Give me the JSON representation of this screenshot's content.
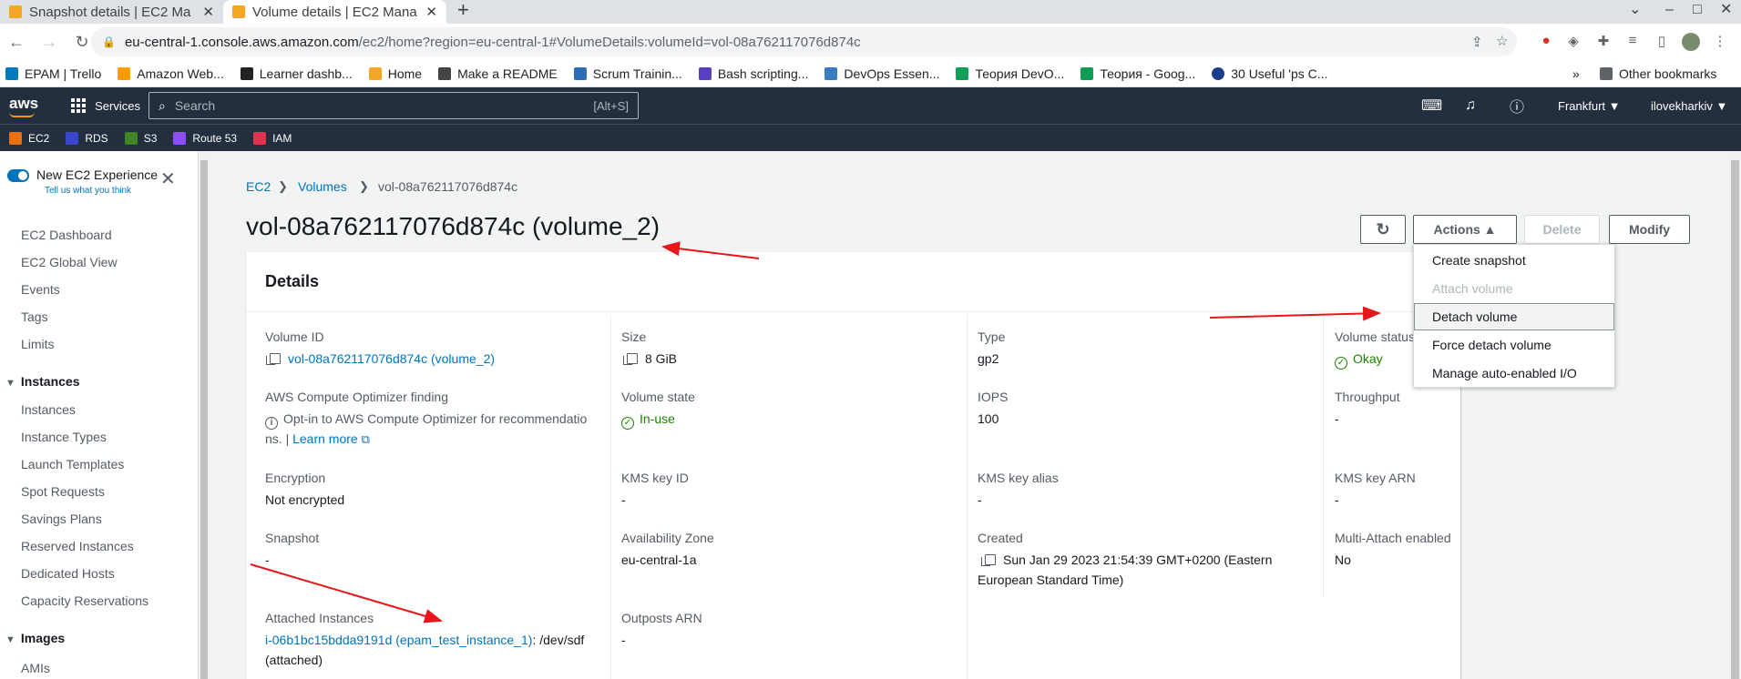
{
  "browser": {
    "tabs": [
      {
        "title": "Snapshot details | EC2 Ma"
      },
      {
        "title": "Volume details | EC2 Mana"
      }
    ],
    "url_host": "eu-central-1.console.aws.amazon.com",
    "url_rest": "/ec2/home?region=eu-central-1#VolumeDetails:volumeId=vol-08a762117076d874c",
    "bookmarks": [
      {
        "label": "EPAM | Trello",
        "color": "#0079bf"
      },
      {
        "label": "Amazon Web...",
        "color": "#ff9900"
      },
      {
        "label": "Learner dashb...",
        "color": "#222222"
      },
      {
        "label": "Home",
        "color": "#f5a623"
      },
      {
        "label": "Make a README",
        "color": "#444444"
      },
      {
        "label": "Scrum Trainin...",
        "color": "#2d6db5"
      },
      {
        "label": "Bash scripting...",
        "color": "#5a3fc0"
      },
      {
        "label": "DevOps Essen...",
        "color": "#3b7bbf"
      },
      {
        "label": "Теория DevO...",
        "color": "#0f9d58"
      },
      {
        "label": "Теория - Goog...",
        "color": "#0f9d58"
      },
      {
        "label": "30 Useful 'ps C...",
        "color": "#1a3c8a"
      }
    ],
    "more_bookmarks": "»",
    "other_bookmarks": "Other bookmarks"
  },
  "aws_nav": {
    "logo": "aws",
    "services": "Services",
    "search_placeholder": "Search",
    "search_hint": "[Alt+S]",
    "region": "Frankfurt ▼",
    "user": "ilovekharkiv ▼"
  },
  "favorites": [
    {
      "label": "EC2",
      "color": "#ec7211"
    },
    {
      "label": "RDS",
      "color": "#3b48cc"
    },
    {
      "label": "S3",
      "color": "#3f8624"
    },
    {
      "label": "Route 53",
      "color": "#8c4fff"
    },
    {
      "label": "IAM",
      "color": "#dd344c"
    }
  ],
  "sidebar": {
    "new_experience": "New EC2 Experience",
    "feedback": "Tell us what you think",
    "items_top": [
      "EC2 Dashboard",
      "EC2 Global View",
      "Events",
      "Tags",
      "Limits"
    ],
    "section_instances": "Instances",
    "items_instances": [
      "Instances",
      "Instance Types",
      "Launch Templates",
      "Spot Requests",
      "Savings Plans",
      "Reserved Instances",
      "Dedicated Hosts",
      "Capacity Reservations"
    ],
    "section_images": "Images",
    "items_images": [
      "AMIs"
    ]
  },
  "breadcrumb": {
    "ec2": "EC2",
    "volumes": "Volumes",
    "current": "vol-08a762117076d874c"
  },
  "page_title": "vol-08a762117076d874c (volume_2)",
  "buttons": {
    "actions": "Actions ▲",
    "delete": "Delete",
    "modify": "Modify"
  },
  "details": {
    "heading": "Details",
    "volume_id_label": "Volume ID",
    "volume_id": "vol-08a762117076d874c (volume_2)",
    "size_label": "Size",
    "size": "8 GiB",
    "type_label": "Type",
    "type": "gp2",
    "volume_status_label": "Volume status",
    "volume_status": "Okay",
    "optimizer_label": "AWS Compute Optimizer finding",
    "optimizer_line1": "Opt-in to AWS Compute Optimizer for recommendatio",
    "optimizer_line2": "ns. |",
    "learn_more": "Learn more",
    "volume_state_label": "Volume state",
    "volume_state": "In-use",
    "iops_label": "IOPS",
    "iops": "100",
    "throughput_label": "Throughput",
    "throughput": "-",
    "encryption_label": "Encryption",
    "encryption": "Not encrypted",
    "kms_key_id_label": "KMS key ID",
    "kms_key_id": "-",
    "kms_alias_label": "KMS key alias",
    "kms_alias": "-",
    "kms_arn_label": "KMS key ARN",
    "kms_arn": "-",
    "snapshot_label": "Snapshot",
    "snapshot": "-",
    "az_label": "Availability Zone",
    "az": "eu-central-1a",
    "created_label": "Created",
    "created_line1": "Sun Jan 29 2023 21:54:39 GMT+0200 (Eastern",
    "created_line2": "European Standard Time)",
    "multi_attach_label": "Multi-Attach enabled",
    "multi_attach": "No",
    "attached_label": "Attached Instances",
    "attached_link": "i-06b1bc15bdda9191d (epam_test_instance_1)",
    "attached_suffix": ": /dev/sdf",
    "attached_line2": "(attached)",
    "outposts_label": "Outposts ARN",
    "outposts": "-"
  },
  "actions_menu": {
    "items": [
      "Create snapshot",
      "Attach volume",
      "Detach volume",
      "Force detach volume",
      "Manage auto-enabled I/O"
    ]
  },
  "colors": {
    "aws_nav": "#232f3e",
    "link": "#0073bb",
    "success": "#1d8102",
    "annotation": "#e8151b"
  }
}
